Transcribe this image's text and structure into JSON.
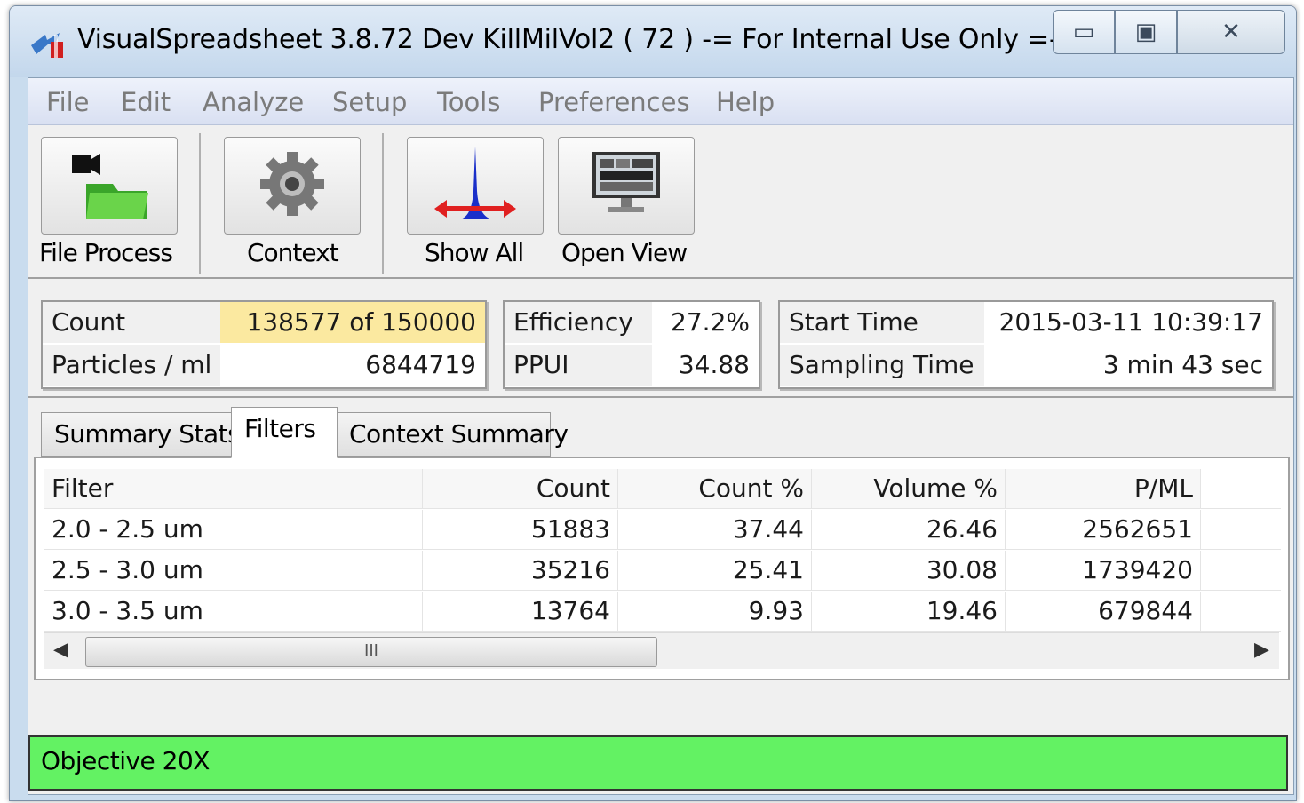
{
  "window": {
    "title": "VisualSpreadsheet 3.8.72 Dev KillMilVol2 ( 72 ) -= For Internal Use Only =- ...",
    "controls": {
      "minimize": "▭",
      "maximize": "▣",
      "close": "✕"
    }
  },
  "menu": {
    "items": [
      "File",
      "Edit",
      "Analyze",
      "Setup",
      "Tools",
      "Preferences",
      "Help"
    ]
  },
  "toolbar": {
    "buttons": [
      {
        "label": "File Process",
        "icon": "folder-camera-icon"
      },
      {
        "label": "Context",
        "icon": "gear-icon"
      },
      {
        "label": "Show All",
        "icon": "histogram-arrows-icon"
      },
      {
        "label": "Open View",
        "icon": "monitor-icon"
      }
    ]
  },
  "info": {
    "count_label": "Count",
    "count_value": "138577  of  150000",
    "particles_label": "Particles / ml",
    "particles_value": "6844719",
    "efficiency_label": "Efficiency",
    "efficiency_value": "27.2%",
    "ppui_label": "PPUI",
    "ppui_value": "34.88",
    "start_label": "Start Time",
    "start_value": "2015-03-11  10:39:17",
    "sampling_label": "Sampling Time",
    "sampling_value": "3 min 43 sec"
  },
  "tabs": [
    "Summary Stats",
    "Filters",
    "Context Summary"
  ],
  "active_tab": "Filters",
  "table": {
    "columns": [
      "Filter",
      "Count",
      "Count %",
      "Volume %",
      "P/ML"
    ],
    "rows": [
      [
        "2.0 - 2.5 um",
        "51883",
        "37.44",
        "26.46",
        "2562651"
      ],
      [
        "2.5 - 3.0 um",
        "35216",
        "25.41",
        "30.08",
        "1739420"
      ],
      [
        "3.0 - 3.5 um",
        "13764",
        "9.93",
        "19.46",
        "679844"
      ]
    ],
    "scroll_thumb_text": "III"
  },
  "status": {
    "text": "Objective 20X",
    "color": "#63f263"
  }
}
